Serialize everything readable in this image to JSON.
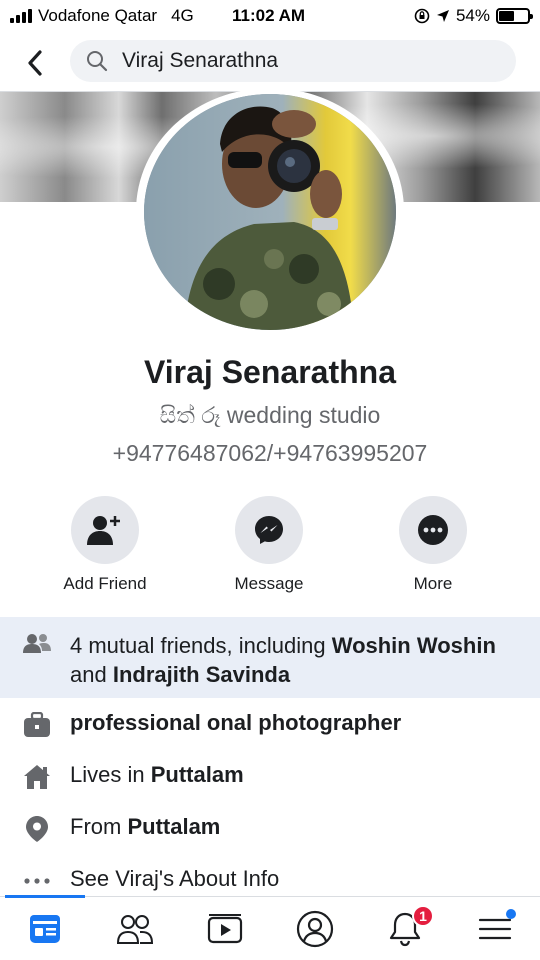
{
  "status_bar": {
    "carrier": "Vodafone Qatar",
    "network": "4G",
    "time": "11:02 AM",
    "battery": "54%",
    "battery_level": 0.54
  },
  "header": {
    "search_value": "Viraj Senarathna"
  },
  "profile": {
    "name": "Viraj Senarathna",
    "bio_line1": "සිත් රූ wedding studio",
    "bio_line2": "+94776487062/+94763995207"
  },
  "actions": [
    {
      "label": "Add Friend",
      "icon": "add-friend-icon"
    },
    {
      "label": "Message",
      "icon": "messenger-icon"
    },
    {
      "label": "More",
      "icon": "more-icon"
    }
  ],
  "mutual": {
    "prefix": "4 mutual friends, including ",
    "friend1": "Woshin Woshin",
    "and": " and ",
    "friend2": "Indrajith Savinda"
  },
  "info": {
    "work": "professional onal photographer",
    "lives_prefix": "Lives in ",
    "lives_value": "Puttalam",
    "from_prefix": "From ",
    "from_value": "Puttalam",
    "about": "See Viraj's About Info"
  },
  "tabbar": {
    "notification_count": "1",
    "active_color": "#1877f2",
    "badge_color": "#e41e3f"
  }
}
